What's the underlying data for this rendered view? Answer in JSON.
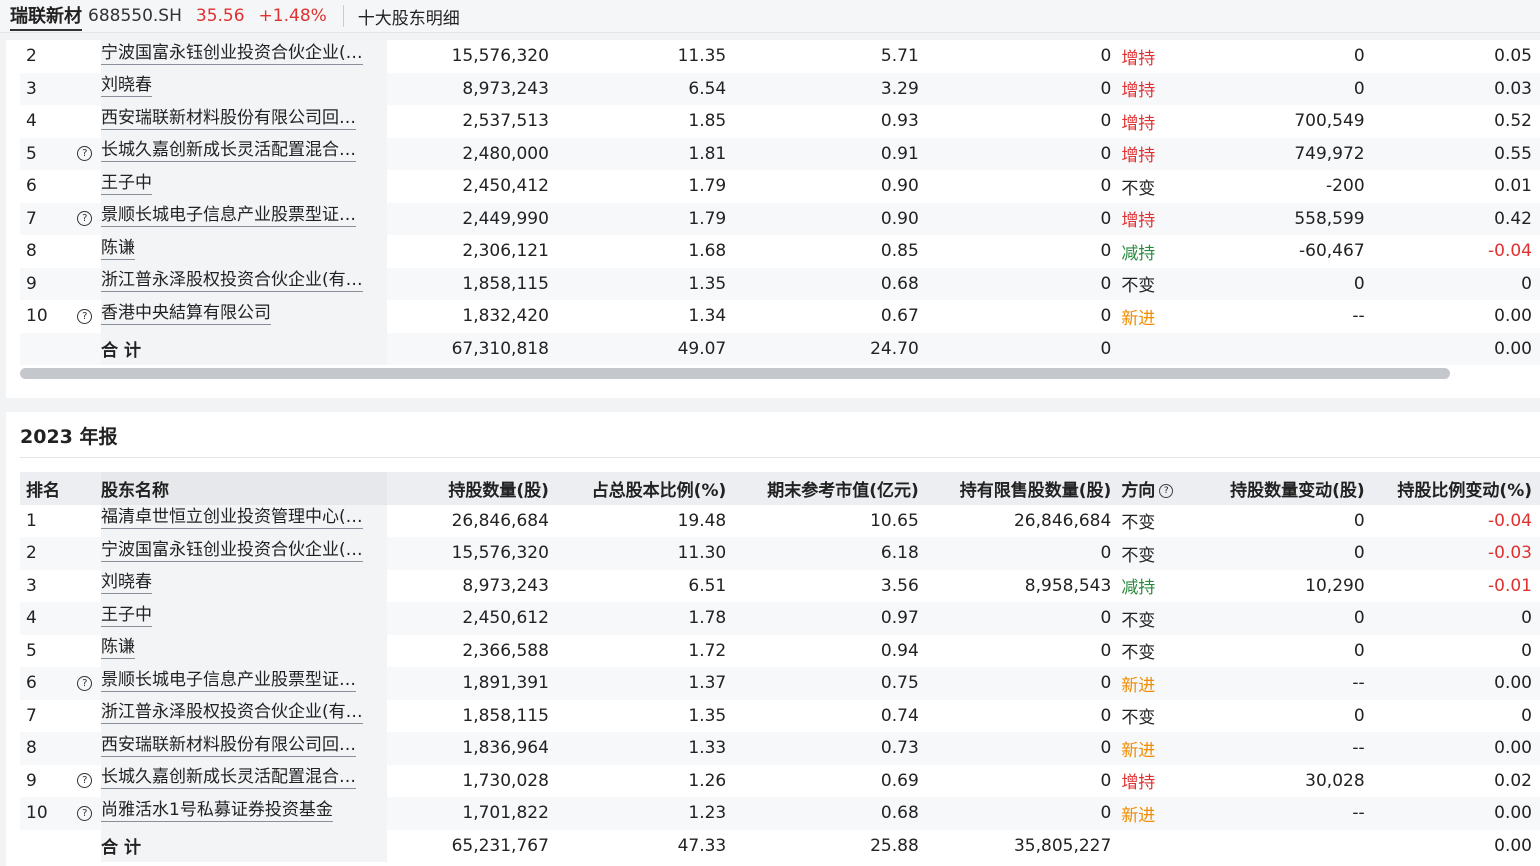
{
  "topbar": {
    "stock_name": "瑞联新材",
    "stock_code": "688550.SH",
    "price": "35.56",
    "change": "+1.48%",
    "tab": "十大股东明细"
  },
  "icons": {
    "question": "question-circle-icon"
  },
  "colors": {
    "up": "#e03131",
    "down": "#2b8a3e",
    "new": "#f08c00"
  },
  "table1": {
    "rows": [
      {
        "rank": "2",
        "q": false,
        "name": "宁波国富永钰创业投资合伙企业(…",
        "shares": "15,576,320",
        "ratio": "11.35",
        "value": "5.71",
        "restricted": "0",
        "dir": "增持",
        "dircls": "dir-up",
        "chg": "0",
        "chgr": "0.05",
        "chgrcls": ""
      },
      {
        "rank": "3",
        "q": false,
        "name": "刘晓春",
        "shares": "8,973,243",
        "ratio": "6.54",
        "value": "3.29",
        "restricted": "0",
        "dir": "增持",
        "dircls": "dir-up",
        "chg": "0",
        "chgr": "0.03",
        "chgrcls": ""
      },
      {
        "rank": "4",
        "q": false,
        "name": "西安瑞联新材料股份有限公司回…",
        "shares": "2,537,513",
        "ratio": "1.85",
        "value": "0.93",
        "restricted": "0",
        "dir": "增持",
        "dircls": "dir-up",
        "chg": "700,549",
        "chgr": "0.52",
        "chgrcls": ""
      },
      {
        "rank": "5",
        "q": true,
        "name": "长城久嘉创新成长灵活配置混合…",
        "shares": "2,480,000",
        "ratio": "1.81",
        "value": "0.91",
        "restricted": "0",
        "dir": "增持",
        "dircls": "dir-up",
        "chg": "749,972",
        "chgr": "0.55",
        "chgrcls": ""
      },
      {
        "rank": "6",
        "q": false,
        "name": "王子中",
        "shares": "2,450,412",
        "ratio": "1.79",
        "value": "0.90",
        "restricted": "0",
        "dir": "不变",
        "dircls": "dir-same",
        "chg": "-200",
        "chgr": "0.01",
        "chgrcls": ""
      },
      {
        "rank": "7",
        "q": true,
        "name": "景顺长城电子信息产业股票型证…",
        "shares": "2,449,990",
        "ratio": "1.79",
        "value": "0.90",
        "restricted": "0",
        "dir": "增持",
        "dircls": "dir-up",
        "chg": "558,599",
        "chgr": "0.42",
        "chgrcls": ""
      },
      {
        "rank": "8",
        "q": false,
        "name": "陈谦",
        "shares": "2,306,121",
        "ratio": "1.68",
        "value": "0.85",
        "restricted": "0",
        "dir": "减持",
        "dircls": "dir-down",
        "chg": "-60,467",
        "chgr": "-0.04",
        "chgrcls": "red"
      },
      {
        "rank": "9",
        "q": false,
        "name": "浙江普永泽股权投资合伙企业(有…",
        "shares": "1,858,115",
        "ratio": "1.35",
        "value": "0.68",
        "restricted": "0",
        "dir": "不变",
        "dircls": "dir-same",
        "chg": "0",
        "chgr": "0",
        "chgrcls": ""
      },
      {
        "rank": "10",
        "q": true,
        "name": "香港中央結算有限公司",
        "shares": "1,832,420",
        "ratio": "1.34",
        "value": "0.67",
        "restricted": "0",
        "dir": "新进",
        "dircls": "dir-new",
        "chg": "--",
        "chgr": "0.00",
        "chgrcls": ""
      }
    ],
    "total": {
      "label": "合 计",
      "shares": "67,310,818",
      "ratio": "49.07",
      "value": "24.70",
      "restricted": "0",
      "chgr": "0.00"
    }
  },
  "table2": {
    "title": "2023 年报",
    "headers": {
      "rank": "排名",
      "name": "股东名称",
      "shares": "持股数量(股)",
      "ratio": "占总股本比例(%)",
      "value": "期末参考市值(亿元)",
      "restricted": "持有限售股数量(股)",
      "dir": "方向",
      "chg": "持股数量变动(股)",
      "chgr": "持股比例变动(%)"
    },
    "rows": [
      {
        "rank": "1",
        "q": false,
        "name": "福清卓世恒立创业投资管理中心(…",
        "shares": "26,846,684",
        "ratio": "19.48",
        "value": "10.65",
        "restricted": "26,846,684",
        "dir": "不变",
        "dircls": "dir-same",
        "chg": "0",
        "chgr": "-0.04",
        "chgrcls": "red"
      },
      {
        "rank": "2",
        "q": false,
        "name": "宁波国富永钰创业投资合伙企业(…",
        "shares": "15,576,320",
        "ratio": "11.30",
        "value": "6.18",
        "restricted": "0",
        "dir": "不变",
        "dircls": "dir-same",
        "chg": "0",
        "chgr": "-0.03",
        "chgrcls": "red"
      },
      {
        "rank": "3",
        "q": false,
        "name": "刘晓春",
        "shares": "8,973,243",
        "ratio": "6.51",
        "value": "3.56",
        "restricted": "8,958,543",
        "dir": "减持",
        "dircls": "dir-down",
        "chg": "10,290",
        "chgr": "-0.01",
        "chgrcls": "red"
      },
      {
        "rank": "4",
        "q": false,
        "name": "王子中",
        "shares": "2,450,612",
        "ratio": "1.78",
        "value": "0.97",
        "restricted": "0",
        "dir": "不变",
        "dircls": "dir-same",
        "chg": "0",
        "chgr": "0",
        "chgrcls": ""
      },
      {
        "rank": "5",
        "q": false,
        "name": "陈谦",
        "shares": "2,366,588",
        "ratio": "1.72",
        "value": "0.94",
        "restricted": "0",
        "dir": "不变",
        "dircls": "dir-same",
        "chg": "0",
        "chgr": "0",
        "chgrcls": ""
      },
      {
        "rank": "6",
        "q": true,
        "name": "景顺长城电子信息产业股票型证…",
        "shares": "1,891,391",
        "ratio": "1.37",
        "value": "0.75",
        "restricted": "0",
        "dir": "新进",
        "dircls": "dir-new",
        "chg": "--",
        "chgr": "0.00",
        "chgrcls": ""
      },
      {
        "rank": "7",
        "q": false,
        "name": "浙江普永泽股权投资合伙企业(有…",
        "shares": "1,858,115",
        "ratio": "1.35",
        "value": "0.74",
        "restricted": "0",
        "dir": "不变",
        "dircls": "dir-same",
        "chg": "0",
        "chgr": "0",
        "chgrcls": ""
      },
      {
        "rank": "8",
        "q": false,
        "name": "西安瑞联新材料股份有限公司回…",
        "shares": "1,836,964",
        "ratio": "1.33",
        "value": "0.73",
        "restricted": "0",
        "dir": "新进",
        "dircls": "dir-new",
        "chg": "--",
        "chgr": "0.00",
        "chgrcls": ""
      },
      {
        "rank": "9",
        "q": true,
        "name": "长城久嘉创新成长灵活配置混合…",
        "shares": "1,730,028",
        "ratio": "1.26",
        "value": "0.69",
        "restricted": "0",
        "dir": "增持",
        "dircls": "dir-up",
        "chg": "30,028",
        "chgr": "0.02",
        "chgrcls": ""
      },
      {
        "rank": "10",
        "q": true,
        "name": "尚雅活水1号私募证券投资基金",
        "shares": "1,701,822",
        "ratio": "1.23",
        "value": "0.68",
        "restricted": "0",
        "dir": "新进",
        "dircls": "dir-new",
        "chg": "--",
        "chgr": "0.00",
        "chgrcls": ""
      }
    ],
    "total": {
      "label": "合 计",
      "shares": "65,231,767",
      "ratio": "47.33",
      "value": "25.88",
      "restricted": "35,805,227",
      "chgr": "0.00"
    }
  }
}
